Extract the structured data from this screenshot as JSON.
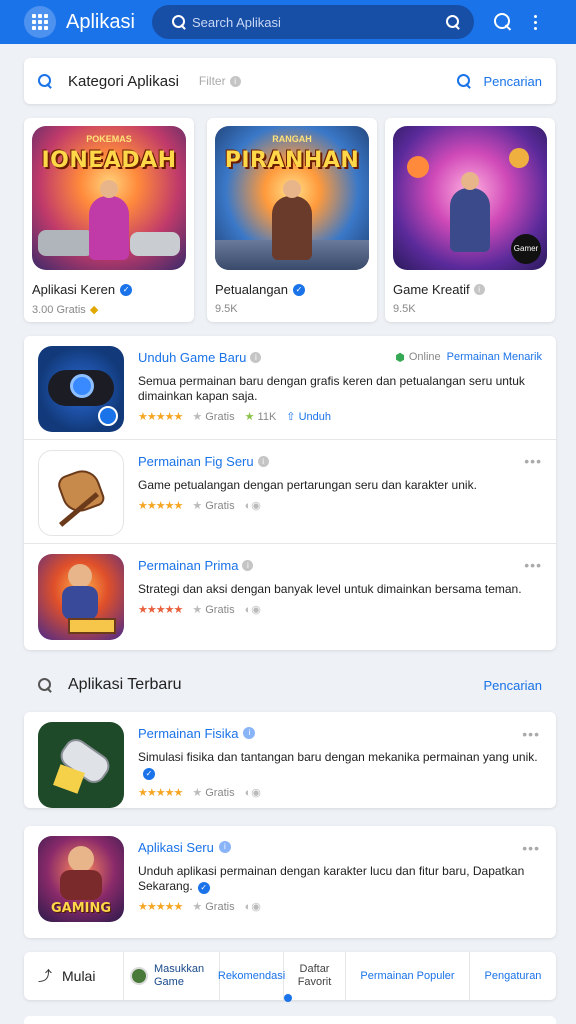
{
  "appbar": {
    "title": "Aplikasi",
    "search_placeholder": "Search Aplikasi",
    "icons": [
      "grid-icon",
      "search-icon",
      "more-vert-icon"
    ]
  },
  "search_card": {
    "label": "Kategori Aplikasi",
    "hint": "Filter",
    "action": "Pencarian"
  },
  "featured": [
    {
      "art_title": "IONEADAH",
      "art_sub": "POKEMAS",
      "name": "Aplikasi Keren",
      "sub": "3.00 Gratis"
    },
    {
      "art_title": "PIRANHAN",
      "art_sub": "RANGAH",
      "name": "Petualangan",
      "sub": "9.5K"
    },
    {
      "art_title": "",
      "art_sub": "",
      "name": "Game Kreatif",
      "sub": "9.5K",
      "logo": "Gamer"
    }
  ],
  "list": [
    {
      "title": "Unduh Game Baru",
      "right_muted": "Online",
      "right_link": "Permainan Menarik",
      "desc": "Semua permainan baru dengan grafis keren dan petualangan seru untuk dimainkan kapan saja.",
      "rating": "★★★★★",
      "meta1": "Gratis",
      "meta2": "11K",
      "meta3": "Unduh"
    },
    {
      "title": "Permainan Fig Seru",
      "desc": "Game petualangan dengan pertarungan seru dan karakter unik.",
      "rating": "★★★★★",
      "meta1": "Gratis",
      "meta2": ""
    },
    {
      "title": "Permainan Prima",
      "desc": "Strategi dan aksi dengan banyak level untuk dimainkan bersama teman.",
      "rating": "★★★★★",
      "meta1": "Gratis",
      "meta2": ""
    }
  ],
  "section2": {
    "label": "Aplikasi Terbaru",
    "action": "Pencarian"
  },
  "singles": [
    {
      "title": "Permainan Fisika",
      "desc": "Simulasi fisika dan tantangan baru dengan mekanika permainan yang unik.",
      "rating": "★★★★★",
      "meta1": "Gratis"
    },
    {
      "title": "Aplikasi Seru",
      "desc": "Unduh aplikasi permainan dengan karakter lucu dan fitur baru, Dapatkan Sekarang.",
      "rating": "★★★★★",
      "meta1": "Gratis",
      "art_title": "GAMING"
    }
  ],
  "bottom_nav": {
    "first": "Mulai",
    "avatar_label": "Masukkan Game",
    "items": [
      "Rekomendasi",
      "Daftar Favorit",
      "Permainan Populer",
      "Pengaturan"
    ]
  }
}
